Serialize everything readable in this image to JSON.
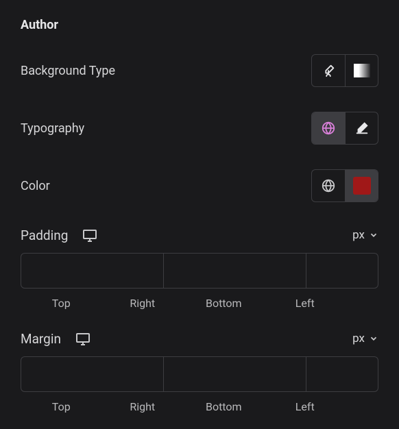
{
  "section": {
    "title": "Author"
  },
  "backgroundType": {
    "label": "Background Type"
  },
  "typography": {
    "label": "Typography"
  },
  "color": {
    "label": "Color",
    "swatch": "#a01818"
  },
  "padding": {
    "label": "Padding",
    "unit": "px",
    "sides": {
      "top": "Top",
      "right": "Right",
      "bottom": "Bottom",
      "left": "Left"
    },
    "values": {
      "top": "",
      "right": "",
      "bottom": "",
      "left": ""
    }
  },
  "margin": {
    "label": "Margin",
    "unit": "px",
    "sides": {
      "top": "Top",
      "right": "Right",
      "bottom": "Bottom",
      "left": "Left"
    },
    "values": {
      "top": "",
      "right": "",
      "bottom": "",
      "left": ""
    }
  }
}
